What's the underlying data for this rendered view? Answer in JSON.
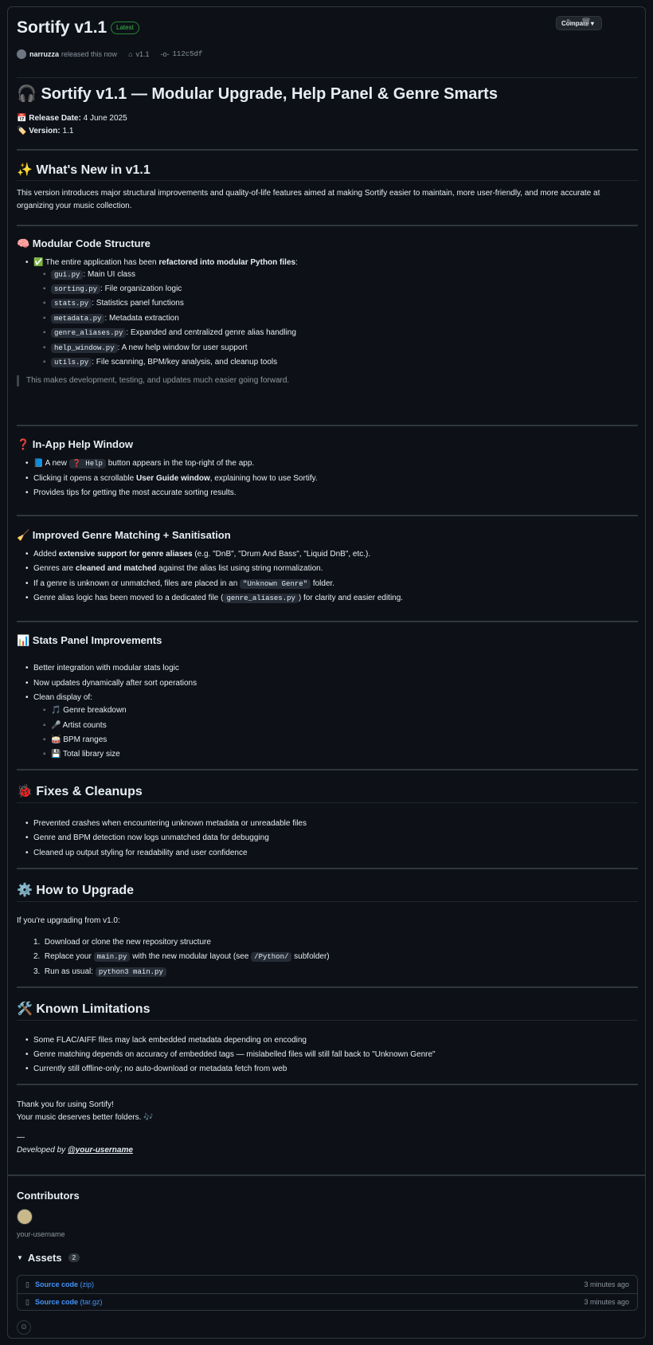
{
  "release": {
    "title": "Sortify v1.1",
    "badge": "Latest",
    "compare_label": "Compare ▾",
    "user": "narruzza",
    "released_text": "released this now",
    "tag": "v1.1",
    "commit": "112c5df"
  },
  "heading": "🎧 Sortify v1.1 — Modular Upgrade, Help Panel & Genre Smarts",
  "release_date_label": "Release Date:",
  "release_date": "4 June 2025",
  "version_label": "Version:",
  "version": "1.1",
  "whats_new": {
    "title": "✨ What's New in v1.1",
    "body": "This version introduces major structural improvements and quality-of-life features aimed at making Sortify easier to maintain, more user-friendly, and more accurate at organizing your music collection."
  },
  "modular": {
    "title": "🧠 Modular Code Structure",
    "intro_prefix": "✅ The entire application has been ",
    "intro_bold": "refactored into modular Python files",
    "intro_suffix": ":",
    "files": [
      {
        "code": "gui.py",
        "desc": ": Main UI class"
      },
      {
        "code": "sorting.py",
        "desc": ": File organization logic"
      },
      {
        "code": "stats.py",
        "desc": ": Statistics panel functions"
      },
      {
        "code": "metadata.py",
        "desc": ": Metadata extraction"
      },
      {
        "code": "genre_aliases.py",
        "desc": ": Expanded and centralized genre alias handling"
      },
      {
        "code": "help_window.py",
        "desc": ": A new help window for user support"
      },
      {
        "code": "utils.py",
        "desc": ": File scanning, BPM/key analysis, and cleanup tools"
      }
    ],
    "quote": "This makes development, testing, and updates much easier going forward."
  },
  "help": {
    "title": "❓ In-App Help Window",
    "item1_prefix": "📘 A new ",
    "item1_code": "❓ Help",
    "item1_suffix": " button appears in the top-right of the app.",
    "item2_prefix": "Clicking it opens a scrollable ",
    "item2_bold": "User Guide window",
    "item2_suffix": ", explaining how to use Sortify.",
    "item3": "Provides tips for getting the most accurate sorting results."
  },
  "genre": {
    "title": "🧹 Improved Genre Matching + Sanitisation",
    "item1_prefix": "Added ",
    "item1_bold": "extensive support for genre aliases",
    "item1_suffix": " (e.g. \"DnB\", \"Drum And Bass\", \"Liquid DnB\", etc.).",
    "item2_prefix": "Genres are ",
    "item2_bold": "cleaned and matched",
    "item2_suffix": " against the alias list using string normalization.",
    "item3_prefix": "If a genre is unknown or unmatched, files are placed in an ",
    "item3_code": "\"Unknown Genre\"",
    "item3_suffix": " folder.",
    "item4_prefix": "Genre alias logic has been moved to a dedicated file (",
    "item4_code": "genre_aliases.py",
    "item4_suffix": ") for clarity and easier editing."
  },
  "stats": {
    "title": "📊 Stats Panel Improvements",
    "items": [
      "Better integration with modular stats logic",
      "Now updates dynamically after sort operations",
      "Clean display of:"
    ],
    "sub": [
      "🎵 Genre breakdown",
      "🎤 Artist counts",
      "🥁 BPM ranges",
      "💾 Total library size"
    ]
  },
  "fixes": {
    "title": "🐞 Fixes & Cleanups",
    "items": [
      "Prevented crashes when encountering unknown metadata or unreadable files",
      "Genre and BPM detection now logs unmatched data for debugging",
      "Cleaned up output styling for readability and user confidence"
    ]
  },
  "upgrade": {
    "title": "⚙️ How to Upgrade",
    "intro": "If you're upgrading from v1.0:",
    "step1": "Download or clone the new repository structure",
    "step2_prefix": "Replace your ",
    "step2_code": "main.py",
    "step2_mid": " with the new modular layout (see ",
    "step2_code2": "/Python/",
    "step2_suffix": " subfolder)",
    "step3_prefix": "Run as usual: ",
    "step3_code": "python3 main.py"
  },
  "limits": {
    "title": "🛠️ Known Limitations",
    "items": [
      "Some FLAC/AIFF files may lack embedded metadata depending on encoding",
      "Genre matching depends on accuracy of embedded tags — mislabelled files will still fall back to \"Unknown Genre\"",
      "Currently still offline-only; no auto-download or metadata fetch from web"
    ]
  },
  "footer": {
    "thanks": "Thank you for using Sortify!",
    "music": "Your music deserves better folders. 🎶",
    "dash": "—",
    "dev_prefix": "Developed by ",
    "dev_link": "@your-username"
  },
  "contributors": {
    "title": "Contributors",
    "name": "your-username"
  },
  "assets": {
    "title": "Assets",
    "count": "2",
    "items": [
      {
        "name": "Source code",
        "ext": "(zip)",
        "time": "3 minutes ago"
      },
      {
        "name": "Source code",
        "ext": "(tar.gz)",
        "time": "3 minutes ago"
      }
    ]
  },
  "colors": {
    "background": "#0d1117",
    "border": "#30363d",
    "link": "#4493f8",
    "latest": "#3fb950"
  }
}
